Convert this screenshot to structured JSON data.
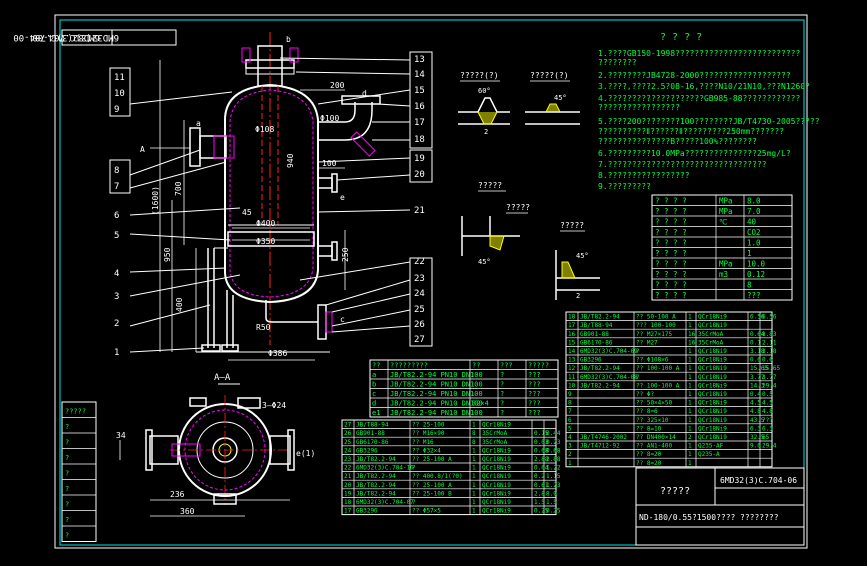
{
  "colors": {
    "background": "#000000",
    "frame": "#ffffff",
    "border": "#00e5e5",
    "annotation": "#ffff00",
    "part": "#ff00ff",
    "centerline": "#ff2020",
    "dimension": "#ffffff",
    "table_text": "#00ff40",
    "outline": "#ffffff"
  },
  "drawing_code": "6MD32(3)C.704-00",
  "drawing_code_title": "6MD32(3)C.704-06",
  "drawing_title": "ND-180/0.55?1500????",
  "drawing_title_suffix": "????????",
  "title_note": "?????",
  "callouts_left": [
    "11",
    "10",
    "9",
    "8",
    "7",
    "6",
    "5",
    "4",
    "3",
    "2",
    "1"
  ],
  "callouts_right": [
    "13",
    "14",
    "15",
    "16",
    "17",
    "18",
    "19",
    "20",
    "21",
    "22",
    "23",
    "24",
    "25",
    "26",
    "27"
  ],
  "dimensions": {
    "top_b": "b",
    "d": "d",
    "a": "a",
    "c": "c",
    "e": "e",
    "dim_200": "200",
    "dim_100": "100",
    "phi100": "Φ100",
    "phi108": "Φ108",
    "phi400": "Φ400",
    "phi350": "Φ350",
    "phi386": "Φ386",
    "r50": "R50",
    "dim_940": "940",
    "dim_700": "700",
    "dim_1600": "(1600)",
    "dim_950": "950",
    "dim_400": "400",
    "dim_250": "250",
    "dim_45": "45",
    "aa": "A",
    "section_title": "A—A",
    "s24": "3—Φ24",
    "e1": "e(1)",
    "d236": "236",
    "d360": "360",
    "d34": "34",
    "angle60": "60°",
    "angle45": "45°",
    "gap2": "2",
    "gap2b": "2"
  },
  "detail_labels": [
    "?????(?)",
    "?????(?)",
    "?????",
    "?????",
    "?????"
  ],
  "notes_title": "? ? ? ?",
  "notes": [
    "1.????GB150-1998??????????????????????????",
    "   ????????",
    "2.????????JB4728-2000???????????????????",
    "3.????,????2.5?08-16,????N10/21N10,???N1260?",
    "4.????????????????????GB985-88????????????",
    "   ?????????????????",
    "5.????200????????100????????JB/T4730-2005?????",
    "   ??????????Ⅱ??????Ⅱ?????????250mm???????",
    "   ???????????????B?????100%????????",
    "6.?????????10.0MPa???????????????25mg/L?",
    "7.?????????????????????????????????",
    "8.?????????????????",
    "9.?????????"
  ],
  "design_table": {
    "rows": [
      {
        "name": "? ? ? ?",
        "unit": "MPa",
        "val": "8.0"
      },
      {
        "name": "? ? ? ?",
        "unit": "MPa",
        "val": "7.0"
      },
      {
        "name": "? ? ? ?",
        "unit": "℃",
        "val": "40"
      },
      {
        "name": "? ? ? ?",
        "unit": "",
        "val": "CO2"
      },
      {
        "name": "? ? ? ?",
        "unit": "",
        "val": "1.0"
      },
      {
        "name": "? ? ? ?",
        "unit": "",
        "val": "1"
      },
      {
        "name": "? ? ? ?",
        "unit": "MPa",
        "val": "10.0"
      },
      {
        "name": "? ? ? ?",
        "unit": "m3",
        "val": "0.12"
      },
      {
        "name": "? ? ? ?",
        "unit": "",
        "val": "8"
      },
      {
        "name": "? ? ? ?",
        "unit": "",
        "val": "???"
      }
    ]
  },
  "nozzle_table": {
    "header": [
      "??",
      "?????????",
      "??",
      "???",
      "?????"
    ],
    "rows": [
      [
        "a",
        "JB/T82.2-94 PN10 DN100",
        "",
        "?",
        "???"
      ],
      [
        "b",
        "JB/T82.2-94 PN10 DN100",
        "",
        "?",
        "???"
      ],
      [
        "c",
        "JB/T82.2-94 PN10 DN100",
        "",
        "?",
        "???"
      ],
      [
        "d",
        "JB/T82.2-94 PN10 DN100",
        "32×4",
        "?",
        "???"
      ],
      [
        "e1",
        "JB/T82.2-94 PN10 DN100",
        "",
        "?",
        "???"
      ]
    ]
  },
  "bom_top": [
    [
      "18",
      "JB/T82.2-94",
      "?? 50-100 A",
      "1",
      "QCr18Ni9",
      "6.56",
      "6.56"
    ],
    [
      "17",
      "JB/T88-94",
      "??? 100-100",
      "1",
      "QCr18Ni9",
      "",
      ""
    ],
    [
      "16",
      "GB901-88",
      "?? M27×175",
      "16",
      "35CrMoA",
      "0.64",
      "8.83"
    ],
    [
      "15",
      "GB6170-86",
      "?? M27",
      "16",
      "35CrMoA",
      "0.1",
      "2.11"
    ],
    [
      "14",
      "6MD32(3)C.704-09",
      "?",
      "1",
      "QCr18Ni9",
      "3.18",
      "3.18"
    ],
    [
      "13",
      "GB3296",
      "?? Φ108×6",
      "1",
      "QCr18Ni9",
      "0.6",
      "0.6"
    ],
    [
      "12",
      "JB/T82.2-94",
      "?? 100-100 A",
      "1",
      "QCr18Ni9",
      "15.65",
      "15.65"
    ],
    [
      "11",
      "6MD32(3)C.704-08",
      "?",
      "1",
      "QCr18Ni9",
      "3.77",
      "3.77"
    ],
    [
      "10",
      "JB/T82.2-94",
      "?? 100-100 A",
      "1",
      "QCr18Ni9",
      "14.3",
      "29.4"
    ],
    [
      "9",
      "",
      "?? Φ?",
      "1",
      "QCr18Ni9",
      "0.4",
      "0.5"
    ],
    [
      "8",
      "",
      "?? 50×4×50",
      "1",
      "QCr18Ni9",
      "4.5",
      "4.5"
    ],
    [
      "7",
      "",
      "?? 8=6",
      "1",
      "QCr18Ni9",
      "4.8",
      "4.8"
    ],
    [
      "6",
      "",
      "?? 325×10",
      "1",
      "QCr18Ni9",
      "43.5",
      "???"
    ],
    [
      "5",
      "",
      "?? 8=10",
      "1",
      "QCr18Ni9",
      "6.3",
      "6.3"
    ],
    [
      "4",
      "JB/T4746-2002",
      "?? DN400×14",
      "2",
      "QCr18Ni9",
      "32.5",
      "65"
    ],
    [
      "3",
      "JB/T4712-92",
      "?? AN1-400",
      "1",
      "Q235-AF",
      "9.6",
      "29.4"
    ],
    [
      "2",
      "",
      "?? 8=20",
      "1",
      "Q235-A",
      "",
      ""
    ],
    [
      "1",
      "",
      "?? 8=20",
      "1",
      "",
      "",
      ""
    ]
  ],
  "bom_bottom": [
    [
      "27",
      "JB/T88-94",
      "?? 25-100",
      "1",
      "QCr18Ni9",
      "",
      ""
    ],
    [
      "26",
      "GB901-88",
      "?? M16×90",
      "8",
      "35CrMoA",
      "0.15",
      "0.44"
    ],
    [
      "25",
      "GB6170-86",
      "?? M16",
      "8",
      "35CrMoA",
      "0.03",
      "0.23"
    ],
    [
      "24",
      "GB3296",
      "?? Φ32×4",
      "1",
      "QCr18Ni9",
      "0.68",
      "0.68"
    ],
    [
      "23",
      "JB/T82.2-94",
      "?? 25-100 A",
      "1",
      "QCr18Ni9",
      "2.88",
      "2.88"
    ],
    [
      "22",
      "6MD32(3)C.704-10",
      "?",
      "1",
      "QCr18Ni9",
      "0.64",
      "1.22"
    ],
    [
      "21",
      "JB/T82.2-94",
      "?? 400.8/1(?0)",
      "1",
      "QCr18Ni9",
      "0.2",
      "1.15"
    ],
    [
      "20",
      "JB/T82.2-94",
      "?? 25-100 A",
      "1",
      "QCr18Ni9",
      "0.61",
      "1.23"
    ],
    [
      "19",
      "JB/T82.2-94",
      "?? 25-100 B",
      "1",
      "QCr18Ni9",
      "2.8",
      "8.0"
    ],
    [
      "18",
      "6MD32(3)C.704-07",
      "?",
      "1",
      "QCr18Ni9",
      "1.5",
      "1.5"
    ],
    [
      "17",
      "GB3296",
      "?? Φ57×5",
      "1",
      "QCr18Ni9",
      "0.25",
      "0.25"
    ]
  ],
  "left_revision_table": [
    "?????",
    "?",
    "?",
    "?",
    "?",
    "?",
    "?",
    "?",
    "?"
  ]
}
